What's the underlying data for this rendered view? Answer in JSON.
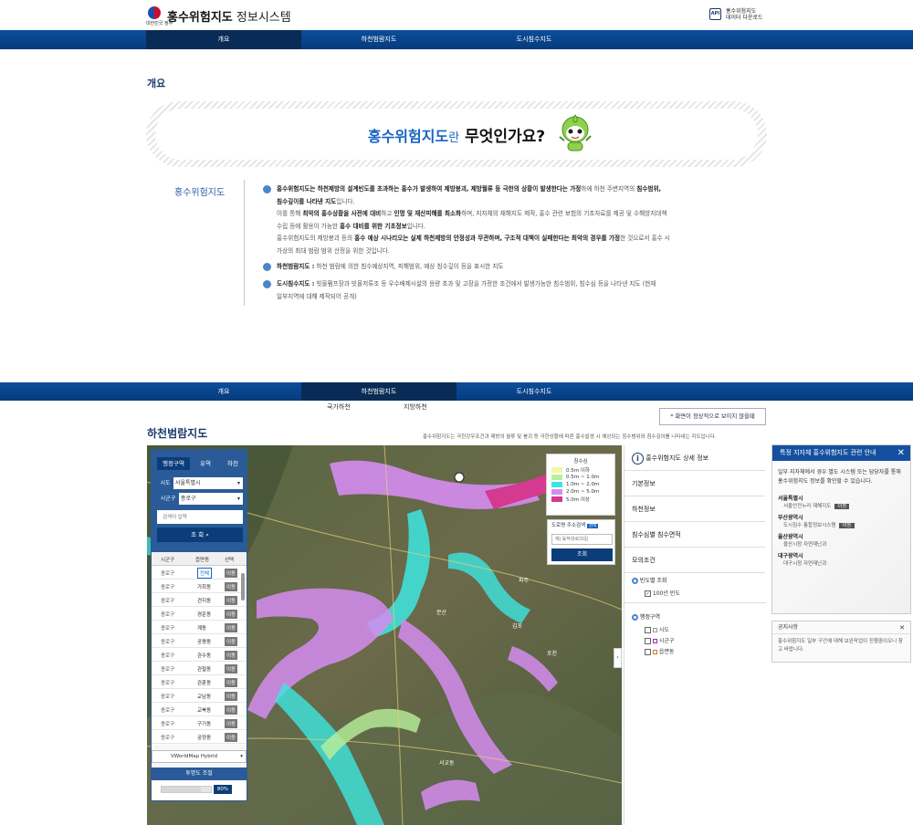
{
  "header": {
    "gov_label": "대한민국 정부",
    "title_bold": "홍수위험지도",
    "title_normal": " 정보시스템",
    "download_icon": "API",
    "download_label_1": "홍수위험지도",
    "download_label_2": "데이터 다운로드"
  },
  "nav": {
    "tabs": [
      {
        "label": "개요"
      },
      {
        "label": "하천범람지도"
      },
      {
        "label": "도시침수지도"
      }
    ]
  },
  "overview": {
    "section_title": "개요",
    "banner_blue": "홍수위험지도",
    "banner_ran": "란",
    "banner_bold": " 무엇인가요?",
    "desc_label": "홍수위험지도",
    "b1_bold1": "홍수위험지도는 하천제방의 설계빈도를 초과하는 홍수가 발생하여 제방붕괴, 제방월류 등 극한의 상황이 발생한다는 가정",
    "b1_t1": "하에 하천 주변지역의 ",
    "b1_bold2": "침수범위,",
    "b1_bold3": "침수깊이를 나타낸 지도",
    "b1_t2": "입니다.",
    "b1_t3": "이를 통해 ",
    "b1_bold4": "최악의 홍수상황을 사전에 대비",
    "b1_t4": "하고 ",
    "b1_bold5": "인명 및 재산피해를 최소화",
    "b1_t5": "하며, 지자체의 재해지도 제작, 홍수 관련 보험의 기초자료를 제공 및 수해방지대책",
    "b1_t6": "수립 등에 활용이 가능한 ",
    "b1_bold6": "홍수 대비를 위한 기초정보",
    "b1_t7": "입니다.",
    "b1_t8": "홍수위험지도의 제방붕괴 등의 ",
    "b1_bold7": "홍수 예상 시나리오는 실제 하천제방의 안정성과 무관하며, 구조적 대책이 실패한다는 최악의 경우를 가정",
    "b1_t9": "한 것으로서 홍수 시",
    "b1_t10": "가상의 최대 범람 범위 산정을 위한 것입니다.",
    "b2_bold": "하천범람지도 :",
    "b2_t": " 하천 범람에 의한 침수예상지역, 피해범위, 예상 침수깊이 등을 표시한 지도",
    "b3_bold": "도시침수지도 :",
    "b3_t": " 빗물펌프장과 빗물저류조 등 우수배제시설의 용량 초과 및 고장을 가정한 조건에서 발생가능한 침수범위, 침수심 등을 나타낸 지도 (현재",
    "b3_t2": "일부지역에 대해 제작되어 공개)"
  },
  "lower": {
    "sub_tabs": [
      "국가하천",
      "지방하천"
    ],
    "notice_btn": "* 화면이 정상적으로 보이지 않을때",
    "map_title": "하천범람지도",
    "map_desc": "홍수위험지도는 극한강우조건과 제방의 월류 및 붕괴 등 극한상황에 따른 홍수발생 시 예상되는 침수범위와 침수깊이를 나타내는 지도입니다.",
    "panel_tabs": [
      "행정구역",
      "유역",
      "하천"
    ],
    "sido_label": "시도",
    "sido_value": "서울특별시",
    "sigungu_label": "시군구",
    "sigungu_value": "종로구",
    "search_placeholder": "검색어 입력",
    "search_btn": "조 회",
    "table_headers": [
      "시군구",
      "읍면동",
      "선택"
    ],
    "rows": [
      {
        "gu": "종로구",
        "dong": "전체",
        "btn": "이동"
      },
      {
        "gu": "종로구",
        "dong": "가회동",
        "btn": "이동"
      },
      {
        "gu": "종로구",
        "dong": "견지동",
        "btn": "이동"
      },
      {
        "gu": "종로구",
        "dong": "경운동",
        "btn": "이동"
      },
      {
        "gu": "종로구",
        "dong": "계동",
        "btn": "이동"
      },
      {
        "gu": "종로구",
        "dong": "공평동",
        "btn": "이동"
      },
      {
        "gu": "종로구",
        "dong": "관수동",
        "btn": "이동"
      },
      {
        "gu": "종로구",
        "dong": "관철동",
        "btn": "이동"
      },
      {
        "gu": "종로구",
        "dong": "관훈동",
        "btn": "이동"
      },
      {
        "gu": "종로구",
        "dong": "교남동",
        "btn": "이동"
      },
      {
        "gu": "종로구",
        "dong": "교북동",
        "btn": "이동"
      },
      {
        "gu": "종로구",
        "dong": "구기동",
        "btn": "이동"
      },
      {
        "gu": "종로구",
        "dong": "궁정동",
        "btn": "이동"
      }
    ],
    "basemap": "VWorldMap Hybrid",
    "opacity_label": "투명도 조절",
    "opacity_value": "80%",
    "opacity_fraction": 0.8,
    "legend_title": "침수심",
    "legend": [
      {
        "label": "0.5m 이하",
        "color": "#f3f7a0"
      },
      {
        "label": "0.5m ~ 1.0m",
        "color": "#b9f09b"
      },
      {
        "label": "1.0m ~ 2.0m",
        "color": "#3de6e0"
      },
      {
        "label": "2.0m ~ 5.0m",
        "color": "#d58cf0"
      },
      {
        "label": "5.0m 이상",
        "color": "#d43a8f"
      }
    ],
    "road_search_label": "도로명 주소검색",
    "road_search_badge": "검색",
    "road_placeholder": "예) 동작대로29길",
    "road_btn": "조회",
    "map_places": [
      "파주",
      "서교동",
      "김포",
      "문산",
      "포천"
    ],
    "info_title": "홍수위험지도 상세 정보",
    "info_items": [
      "기본정보",
      "하천정보",
      "침수심별 침수면적",
      "모의조건"
    ],
    "freq_title": "빈도별 조회",
    "freq_item": "100년 빈도",
    "admin_title": "행정구역",
    "admin_items": [
      "시도",
      "시군구",
      "읍면동"
    ],
    "popup_title": "특정 지자체 홍수위험지도 관련 안내",
    "popup_desc": "일부 지자체에서 경우 별도 시스템 또는 담당자를 통해 홍수위험지도 정보를 확인할 수 있습니다.",
    "popup_items": [
      {
        "city": "서울특별시",
        "sub": "서울안전누리 재해지도",
        "btn": "이동"
      },
      {
        "city": "부산광역시",
        "sub": "도시침수 통합정보시스템",
        "btn": "이동"
      },
      {
        "city": "울산광역시",
        "sub": "울산시청 자연재난과",
        "btn": ""
      },
      {
        "city": "대구광역시",
        "sub": "대구시청 자연재난과",
        "btn": ""
      }
    ],
    "notice_title": "공지사항",
    "notice_text": "홍수위험지도 일부 구간에 대해 보완작업이 진행중이오니 참고 바랍니다."
  }
}
